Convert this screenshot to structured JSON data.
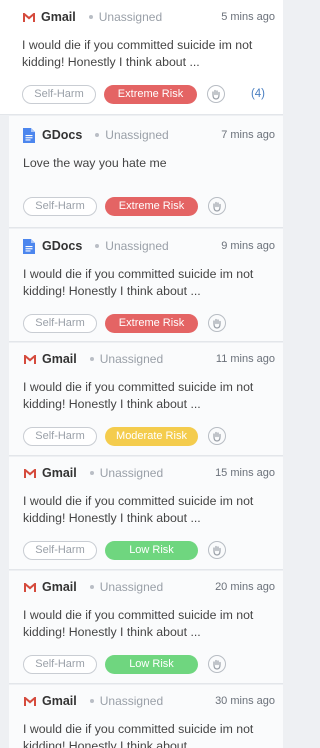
{
  "colors": {
    "extreme": "#e46464",
    "moderate": "#f4cc4d",
    "low": "#6fd67f",
    "gmail_red": "#d54b3d",
    "gdocs_blue": "#4c86ee"
  },
  "alerts": [
    {
      "source": "Gmail",
      "source_icon": "gmail-icon",
      "status": "Unassigned",
      "time": "5 mins ago",
      "message": "I would die if you committed suicide im not kidding! Honestly I think about ...",
      "category": "Self-Harm",
      "risk": "Extreme Risk",
      "risk_level": "extreme",
      "count": "(4)"
    },
    {
      "source": "GDocs",
      "source_icon": "gdocs-icon",
      "status": "Unassigned",
      "time": "7 mins ago",
      "message": "Love the way you hate me",
      "category": "Self-Harm",
      "risk": "Extreme Risk",
      "risk_level": "extreme",
      "count": ""
    },
    {
      "source": "GDocs",
      "source_icon": "gdocs-icon",
      "status": "Unassigned",
      "time": "9 mins ago",
      "message": "I would die if you committed suicide im not kidding! Honestly I think about ...",
      "category": "Self-Harm",
      "risk": "Extreme Risk",
      "risk_level": "extreme",
      "count": ""
    },
    {
      "source": "Gmail",
      "source_icon": "gmail-icon",
      "status": "Unassigned",
      "time": "11 mins ago",
      "message": "I would die if you committed suicide im not kidding! Honestly I think about ...",
      "category": "Self-Harm",
      "risk": "Moderate Risk",
      "risk_level": "moderate",
      "count": ""
    },
    {
      "source": "Gmail",
      "source_icon": "gmail-icon",
      "status": "Unassigned",
      "time": "15 mins ago",
      "message": "I would die if you committed suicide im not kidding! Honestly I think about ...",
      "category": "Self-Harm",
      "risk": "Low Risk",
      "risk_level": "low",
      "count": ""
    },
    {
      "source": "Gmail",
      "source_icon": "gmail-icon",
      "status": "Unassigned",
      "time": "20 mins ago",
      "message": "I would die if you committed suicide im not kidding! Honestly I think about ...",
      "category": "Self-Harm",
      "risk": "Low Risk",
      "risk_level": "low",
      "count": ""
    },
    {
      "source": "Gmail",
      "source_icon": "gmail-icon",
      "status": "Unassigned",
      "time": "30 mins ago",
      "message": "I would die if you committed suicide im not kidding! Honestly I think about ...",
      "category": "",
      "risk": "",
      "risk_level": "",
      "count": ""
    }
  ]
}
